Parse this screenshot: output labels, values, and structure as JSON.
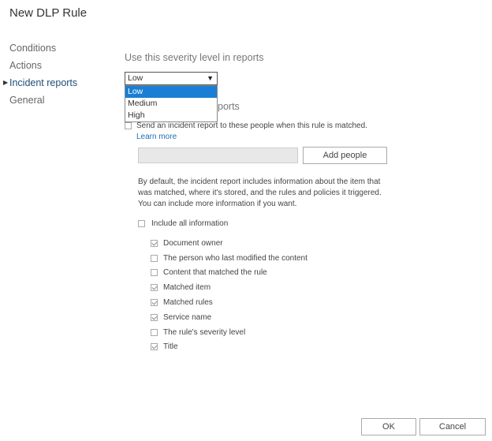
{
  "title": "New DLP Rule",
  "nav": {
    "items": [
      {
        "label": "Conditions",
        "active": false
      },
      {
        "label": "Actions",
        "active": false
      },
      {
        "label": "Incident reports",
        "active": true
      },
      {
        "label": "General",
        "active": false
      }
    ]
  },
  "severity": {
    "label": "Use this severity level in reports",
    "selected": "Low",
    "options": [
      "Low",
      "Medium",
      "High"
    ]
  },
  "incident": {
    "heading_partial": "ports",
    "send_text": "Send an incident report to these people when this rule is matched.",
    "learn_more": "Learn more",
    "send_checked": false,
    "add_people_label": "Add people",
    "people_value": ""
  },
  "info": {
    "description": "By default, the incident report includes information about the item that was matched, where it's stored, and the rules and policies it triggered. You can include more information if you want.",
    "include_all": {
      "label": "Include all information",
      "checked": false
    },
    "options": [
      {
        "label": "Document owner",
        "checked": true
      },
      {
        "label": "The person who last modified the content",
        "checked": false
      },
      {
        "label": "Content that matched the rule",
        "checked": false
      },
      {
        "label": "Matched item",
        "checked": true
      },
      {
        "label": "Matched rules",
        "checked": true
      },
      {
        "label": "Service name",
        "checked": true
      },
      {
        "label": "The rule's severity level",
        "checked": false
      },
      {
        "label": "Title",
        "checked": true
      }
    ]
  },
  "footer": {
    "ok_label": "OK",
    "cancel_label": "Cancel"
  }
}
